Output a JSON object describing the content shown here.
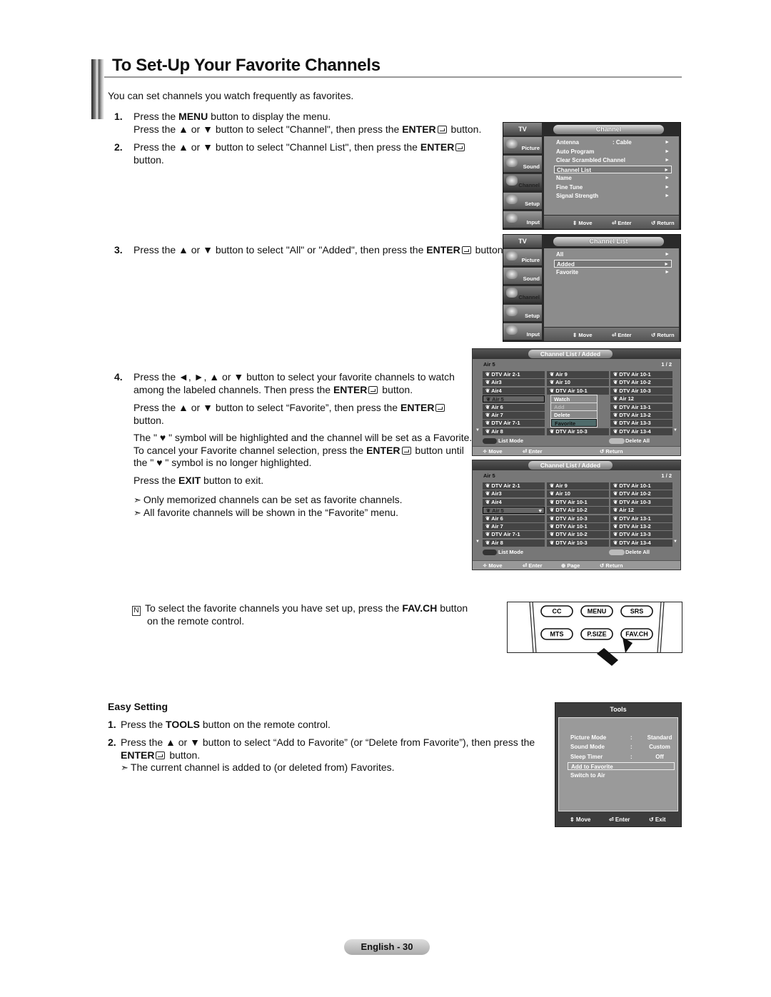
{
  "page": {
    "title": "To Set-Up Your Favorite Channels",
    "intro": "You can set channels you watch frequently as favorites.",
    "steps": [
      {
        "num": "1.",
        "lines": [
          [
            "Press the ",
            {
              "b": "MENU"
            },
            " button to display the menu."
          ],
          [
            "Press the ▲ or ▼ button to select \"Channel\", then press the ",
            {
              "b": "ENTER"
            },
            {
              "icon": "enter-icon"
            },
            " button."
          ]
        ]
      },
      {
        "num": "2.",
        "lines": [
          [
            "Press the ▲ or ▼ button to select \"Channel List\", then press the ",
            {
              "b": "ENTER"
            },
            {
              "icon": "enter-icon"
            }
          ],
          [
            "button."
          ]
        ]
      },
      {
        "num": "3.",
        "lines": [
          [
            "Press the ▲ or ▼ button to select \"All\" or \"Added\", then press the ",
            {
              "b": "ENTER"
            },
            {
              "icon": "enter-icon"
            },
            " button."
          ]
        ]
      },
      {
        "num": "4.",
        "lines": [
          [
            "Press the  ◄, ►, ▲ or ▼ button to select your favorite channels to watch"
          ],
          [
            "among the labeled channels. Then press the ",
            {
              "b": "ENTER"
            },
            {
              "icon": "enter-icon"
            },
            " button."
          ]
        ]
      }
    ],
    "step4_paras": [
      [
        [
          "Press the ▲ or ▼ button to select “Favorite”, then press the ",
          {
            "b": "ENTER"
          },
          {
            "icon": "enter-icon"
          }
        ],
        [
          "button."
        ]
      ],
      [
        [
          "The \" ♥ \" symbol will be highlighted and the channel will be set as a Favorite."
        ],
        [
          "To cancel your Favorite channel selection, press the ",
          {
            "b": "ENTER"
          },
          {
            "icon": "enter-icon"
          },
          " button until"
        ],
        [
          "the \" ♥ \" symbol is no longer highlighted."
        ]
      ],
      [
        [
          "Press the ",
          {
            "b": "EXIT"
          },
          " button to exit."
        ]
      ]
    ],
    "notes": [
      [
        {
          "icon": "note-arrow-icon"
        },
        "Only memorized channels can be set as favorite channels."
      ],
      [
        {
          "icon": "note-arrow-icon"
        },
        "All favorite channels will be shown in the “Favorite” menu."
      ]
    ],
    "fav_note": [
      [
        {
          "icon": "remote-note-icon"
        },
        "To select the favorite channels you have set up, press the ",
        {
          "b": "FAV.CH"
        },
        " button"
      ],
      [
        "on the remote control."
      ]
    ],
    "easy_heading": "Easy Setting",
    "easy_steps": [
      {
        "num": "1.",
        "lines": [
          [
            "Press the ",
            {
              "b": "TOOLS"
            },
            " button on the remote control."
          ]
        ]
      },
      {
        "num": "2.",
        "lines": [
          [
            "Press the ▲ or ▼ button to select “Add to Favorite” (or “Delete from Favorite”), then press the"
          ],
          [
            {
              "b": "ENTER"
            },
            {
              "icon": "enter-icon"
            },
            " button."
          ],
          [
            {
              "icon": "note-arrow-icon"
            },
            "The current channel is added to (or deleted from) Favorites."
          ]
        ]
      }
    ],
    "footer": "English - 30"
  },
  "tv_menus": [
    {
      "tv": "TV",
      "title": "Channel",
      "sidebar": [
        "Picture",
        "Sound",
        "Channel",
        "Setup",
        "Input"
      ],
      "active": "Channel",
      "items": [
        {
          "label": "Antenna",
          "value": ": Cable"
        },
        {
          "label": "Auto Program"
        },
        {
          "label": "Clear Scrambled Channel"
        },
        {
          "label": "Channel List",
          "selected": true
        },
        {
          "label": "Name"
        },
        {
          "label": "Fine Tune"
        },
        {
          "label": "Signal Strength"
        }
      ],
      "footer": [
        "Move",
        "Enter",
        "Return"
      ]
    },
    {
      "tv": "TV",
      "title": "Channel List",
      "sidebar": [
        "Picture",
        "Sound",
        "Channel",
        "Setup",
        "Input"
      ],
      "active": "Channel",
      "items": [
        {
          "label": "All"
        },
        {
          "label": "Added",
          "selected": true
        },
        {
          "label": "Favorite"
        }
      ],
      "footer": [
        "Move",
        "Enter",
        "Return"
      ]
    }
  ],
  "channel_lists": [
    {
      "title": "Channel List / Added",
      "current": "Air 5",
      "page": "1 / 2",
      "columns": [
        [
          "DTV Air 2-1",
          "Air3",
          "Air4",
          "Air 5",
          "Air 6",
          "Air 7",
          "DTV Air 7-1",
          "Air 8"
        ],
        [
          "Air 9",
          "Air 10",
          "DTV Air 10-1",
          "",
          "",
          "",
          "",
          "DTV Air 10-3"
        ],
        [
          "DTV Air 10-1",
          "DTV Air 10-2",
          "DTV Air 10-3",
          "Air 12",
          "DTV Air 13-1",
          "DTV Air 13-2",
          "DTV Air 13-3",
          "DTV Air 13-4"
        ]
      ],
      "selected": "Air 5",
      "popup": {
        "items": [
          "Watch",
          "Add",
          "Delete",
          "Favorite"
        ],
        "selected": "Favorite",
        "disabled": "Add"
      },
      "list_mode": "List Mode",
      "delete_all": "Delete All",
      "nav": [
        "Move",
        "Enter",
        "Return"
      ]
    },
    {
      "title": "Channel List / Added",
      "current": "Air 5",
      "page": "1 / 2",
      "columns": [
        [
          "DTV Air 2-1",
          "Air3",
          "Air4",
          "Air 5",
          "Air 6",
          "Air 7",
          "DTV Air 7-1",
          "Air 8"
        ],
        [
          "Air 9",
          "Air 10",
          "DTV Air 10-1",
          "DTV Air 10-2",
          "DTV Air 10-3",
          "DTV Air 10-1",
          "DTV Air 10-2",
          "DTV Air 10-3"
        ],
        [
          "DTV Air 10-1",
          "DTV Air 10-2",
          "DTV Air 10-3",
          "Air 12",
          "DTV Air 13-1",
          "DTV Air 13-2",
          "DTV Air 13-3",
          "DTV Air 13-4"
        ]
      ],
      "selected": "Air 5",
      "favorite": "Air 5",
      "list_mode": "List Mode",
      "delete_all": "Delete All",
      "nav": [
        "Move",
        "Enter",
        "Page",
        "Return"
      ]
    }
  ],
  "remote": {
    "buttons": [
      [
        "CC",
        "MENU",
        "SRS"
      ],
      [
        "MTS",
        "P.SIZE",
        "FAV.CH"
      ]
    ],
    "highlighted": "FAV.CH"
  },
  "tools_menu": {
    "title": "Tools",
    "items": [
      {
        "label": "Picture Mode",
        "sep": ":",
        "value": "Standard"
      },
      {
        "label": "Sound Mode",
        "sep": ":",
        "value": "Custom"
      },
      {
        "label": "Sleep Timer",
        "sep": ":",
        "value": "Off"
      },
      {
        "label": "Add to Favorite",
        "selected": true
      },
      {
        "label": "Switch to Air"
      }
    ],
    "footer": [
      "Move",
      "Enter",
      "Exit"
    ]
  }
}
